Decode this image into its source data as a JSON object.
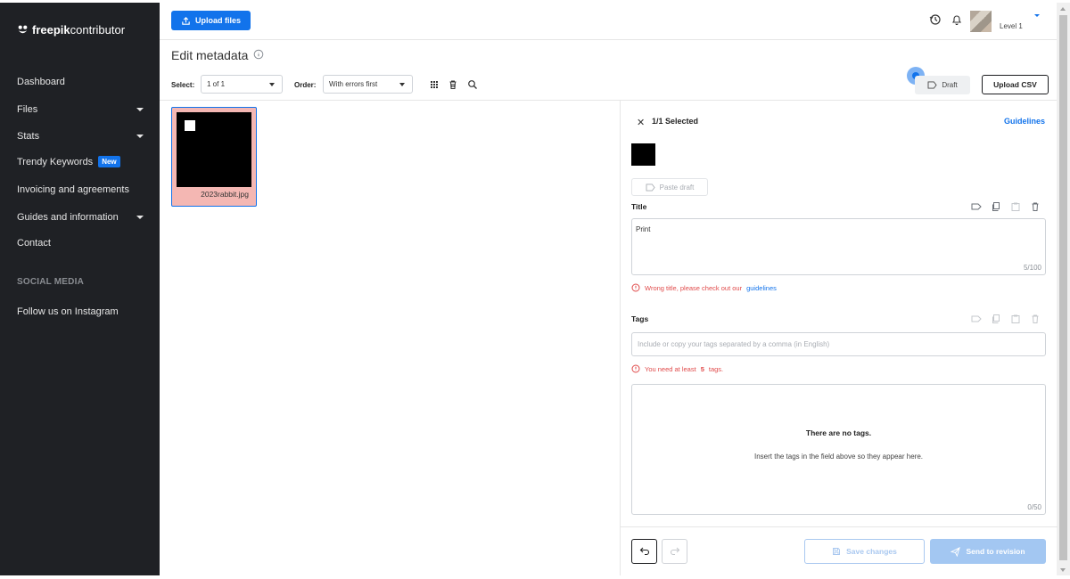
{
  "sidebar": {
    "logo": {
      "bold": "freepik",
      "light": "contributor"
    },
    "items": [
      {
        "label": "Dashboard",
        "has_caret": false
      },
      {
        "label": "Files",
        "has_caret": true
      },
      {
        "label": "Stats",
        "has_caret": true
      },
      {
        "label": "Trendy Keywords",
        "badge": "New",
        "has_caret": false
      },
      {
        "label": "Invoicing and agreements",
        "has_caret": false
      },
      {
        "label": "Guides and information",
        "has_caret": true
      },
      {
        "label": "Contact",
        "has_caret": false
      }
    ],
    "section_title": "SOCIAL MEDIA",
    "social_items": [
      {
        "label": "Follow us on Instagram"
      }
    ]
  },
  "topbar": {
    "upload_label": "Upload files",
    "user_level": "Level 1",
    "icons": [
      "history-icon",
      "bell-icon"
    ]
  },
  "toolbar": {
    "page_title": "Edit metadata",
    "select_label": "Select:",
    "select_value": "1 of 1",
    "order_label": "Order:",
    "order_value": "With errors first",
    "draft_label": "Draft",
    "upload_csv_label": "Upload CSV"
  },
  "files": [
    {
      "name": "2023rabbit.jpg",
      "status": "error"
    }
  ],
  "panel": {
    "selected_text": "1/1 Selected",
    "guidelines_link": "Guidelines",
    "paste_draft_label": "Paste draft",
    "title_field": {
      "label": "Title",
      "value": "Print",
      "counter": "5/100",
      "error_text": "Wrong title, please check out our",
      "error_link": "guidelines"
    },
    "tags_field": {
      "label": "Tags",
      "placeholder": "Include or copy your tags separated by a comma (in English)",
      "error_pre": "You need at least",
      "error_num": "5",
      "error_post": "tags.",
      "empty_title": "There are no tags.",
      "empty_sub": "Insert the tags in the field above so they appear here.",
      "counter": "0/50"
    },
    "save_label": "Save changes",
    "send_label": "Send to revision"
  },
  "colors": {
    "accent": "#1273eb",
    "sidebar_bg": "#1f2125",
    "error": "#e04a4a",
    "thumb_error_bg": "#f4b7b3"
  }
}
